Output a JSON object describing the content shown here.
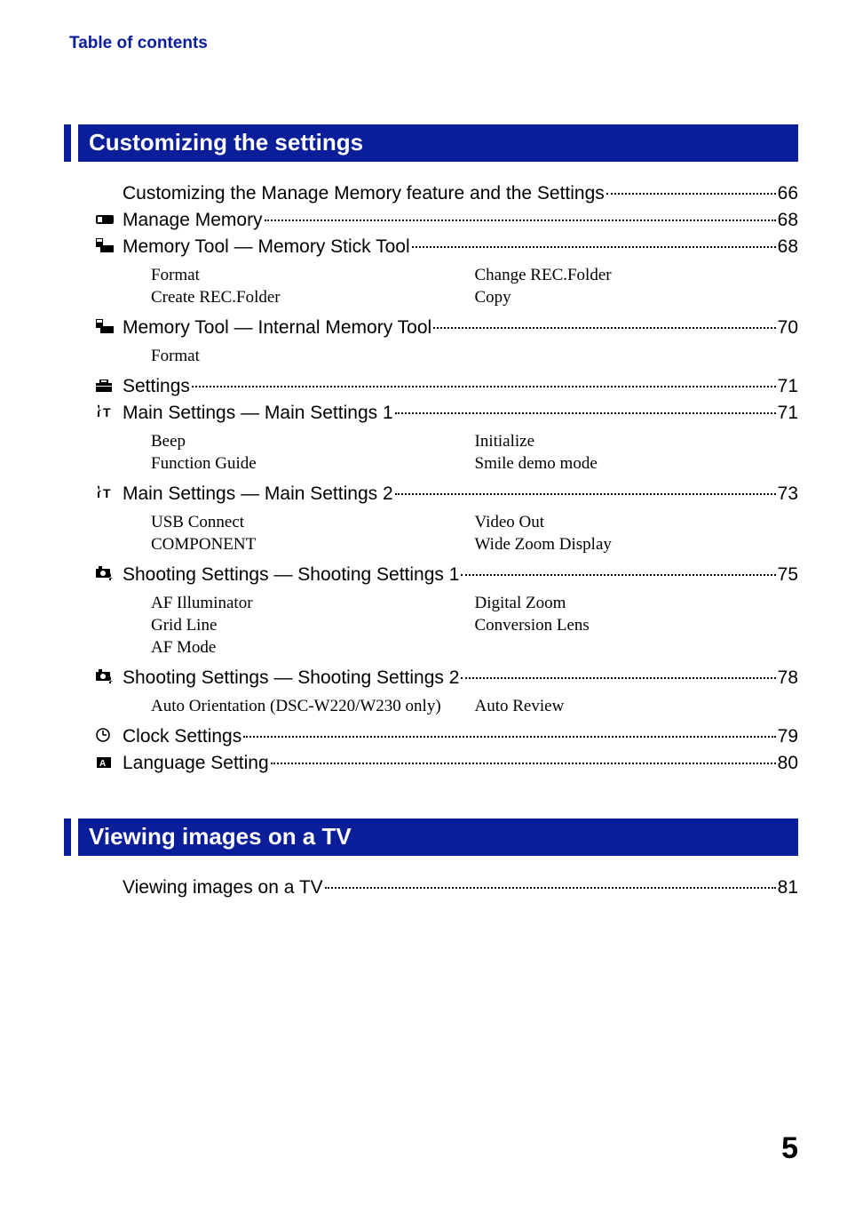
{
  "header": "Table of contents",
  "page_number": "5",
  "sections": [
    {
      "title": "Customizing the settings",
      "entries": [
        {
          "icon": "none",
          "label": "Customizing the Manage Memory feature and the Settings",
          "page": "66"
        },
        {
          "icon": "card",
          "label": "Manage Memory",
          "page": "68"
        },
        {
          "icon": "chip",
          "label": "Memory Tool — Memory Stick Tool",
          "page": "68",
          "sub": {
            "left": [
              "Format",
              "Create REC.Folder"
            ],
            "right": [
              "Change REC.Folder",
              "Copy"
            ]
          }
        },
        {
          "icon": "chip",
          "label": "Memory Tool — Internal Memory Tool",
          "page": "70",
          "sub": {
            "left": [
              "Format"
            ],
            "right": []
          }
        },
        {
          "icon": "toolbox",
          "label": "Settings",
          "page": "71"
        },
        {
          "icon": "wrenchT",
          "label": "Main Settings — Main Settings 1",
          "page": "71",
          "sub": {
            "left": [
              "Beep",
              "Function Guide"
            ],
            "right": [
              "Initialize",
              "Smile demo mode"
            ]
          }
        },
        {
          "icon": "wrenchT",
          "label": "Main Settings — Main Settings 2",
          "page": "73",
          "sub": {
            "left": [
              "USB Connect",
              "COMPONENT"
            ],
            "right": [
              "Video Out",
              "Wide Zoom Display"
            ]
          }
        },
        {
          "icon": "camwrench",
          "label": "Shooting Settings — Shooting Settings 1",
          "page": "75",
          "sub": {
            "left": [
              "AF Illuminator",
              "Grid Line",
              "AF Mode"
            ],
            "right": [
              "Digital Zoom",
              "Conversion Lens"
            ]
          }
        },
        {
          "icon": "camwrench",
          "label": "Shooting Settings — Shooting Settings 2",
          "page": "78",
          "sub": {
            "left": [
              "Auto Orientation (DSC-W220/W230 only)"
            ],
            "right": [
              "Auto Review"
            ]
          }
        },
        {
          "icon": "clock",
          "label": "Clock Settings",
          "page": "79"
        },
        {
          "icon": "lang",
          "label": "Language Setting",
          "page": "80"
        }
      ]
    },
    {
      "title": "Viewing images on a TV",
      "entries": [
        {
          "icon": "none",
          "label": "Viewing images on a TV",
          "page": "81"
        }
      ]
    }
  ]
}
